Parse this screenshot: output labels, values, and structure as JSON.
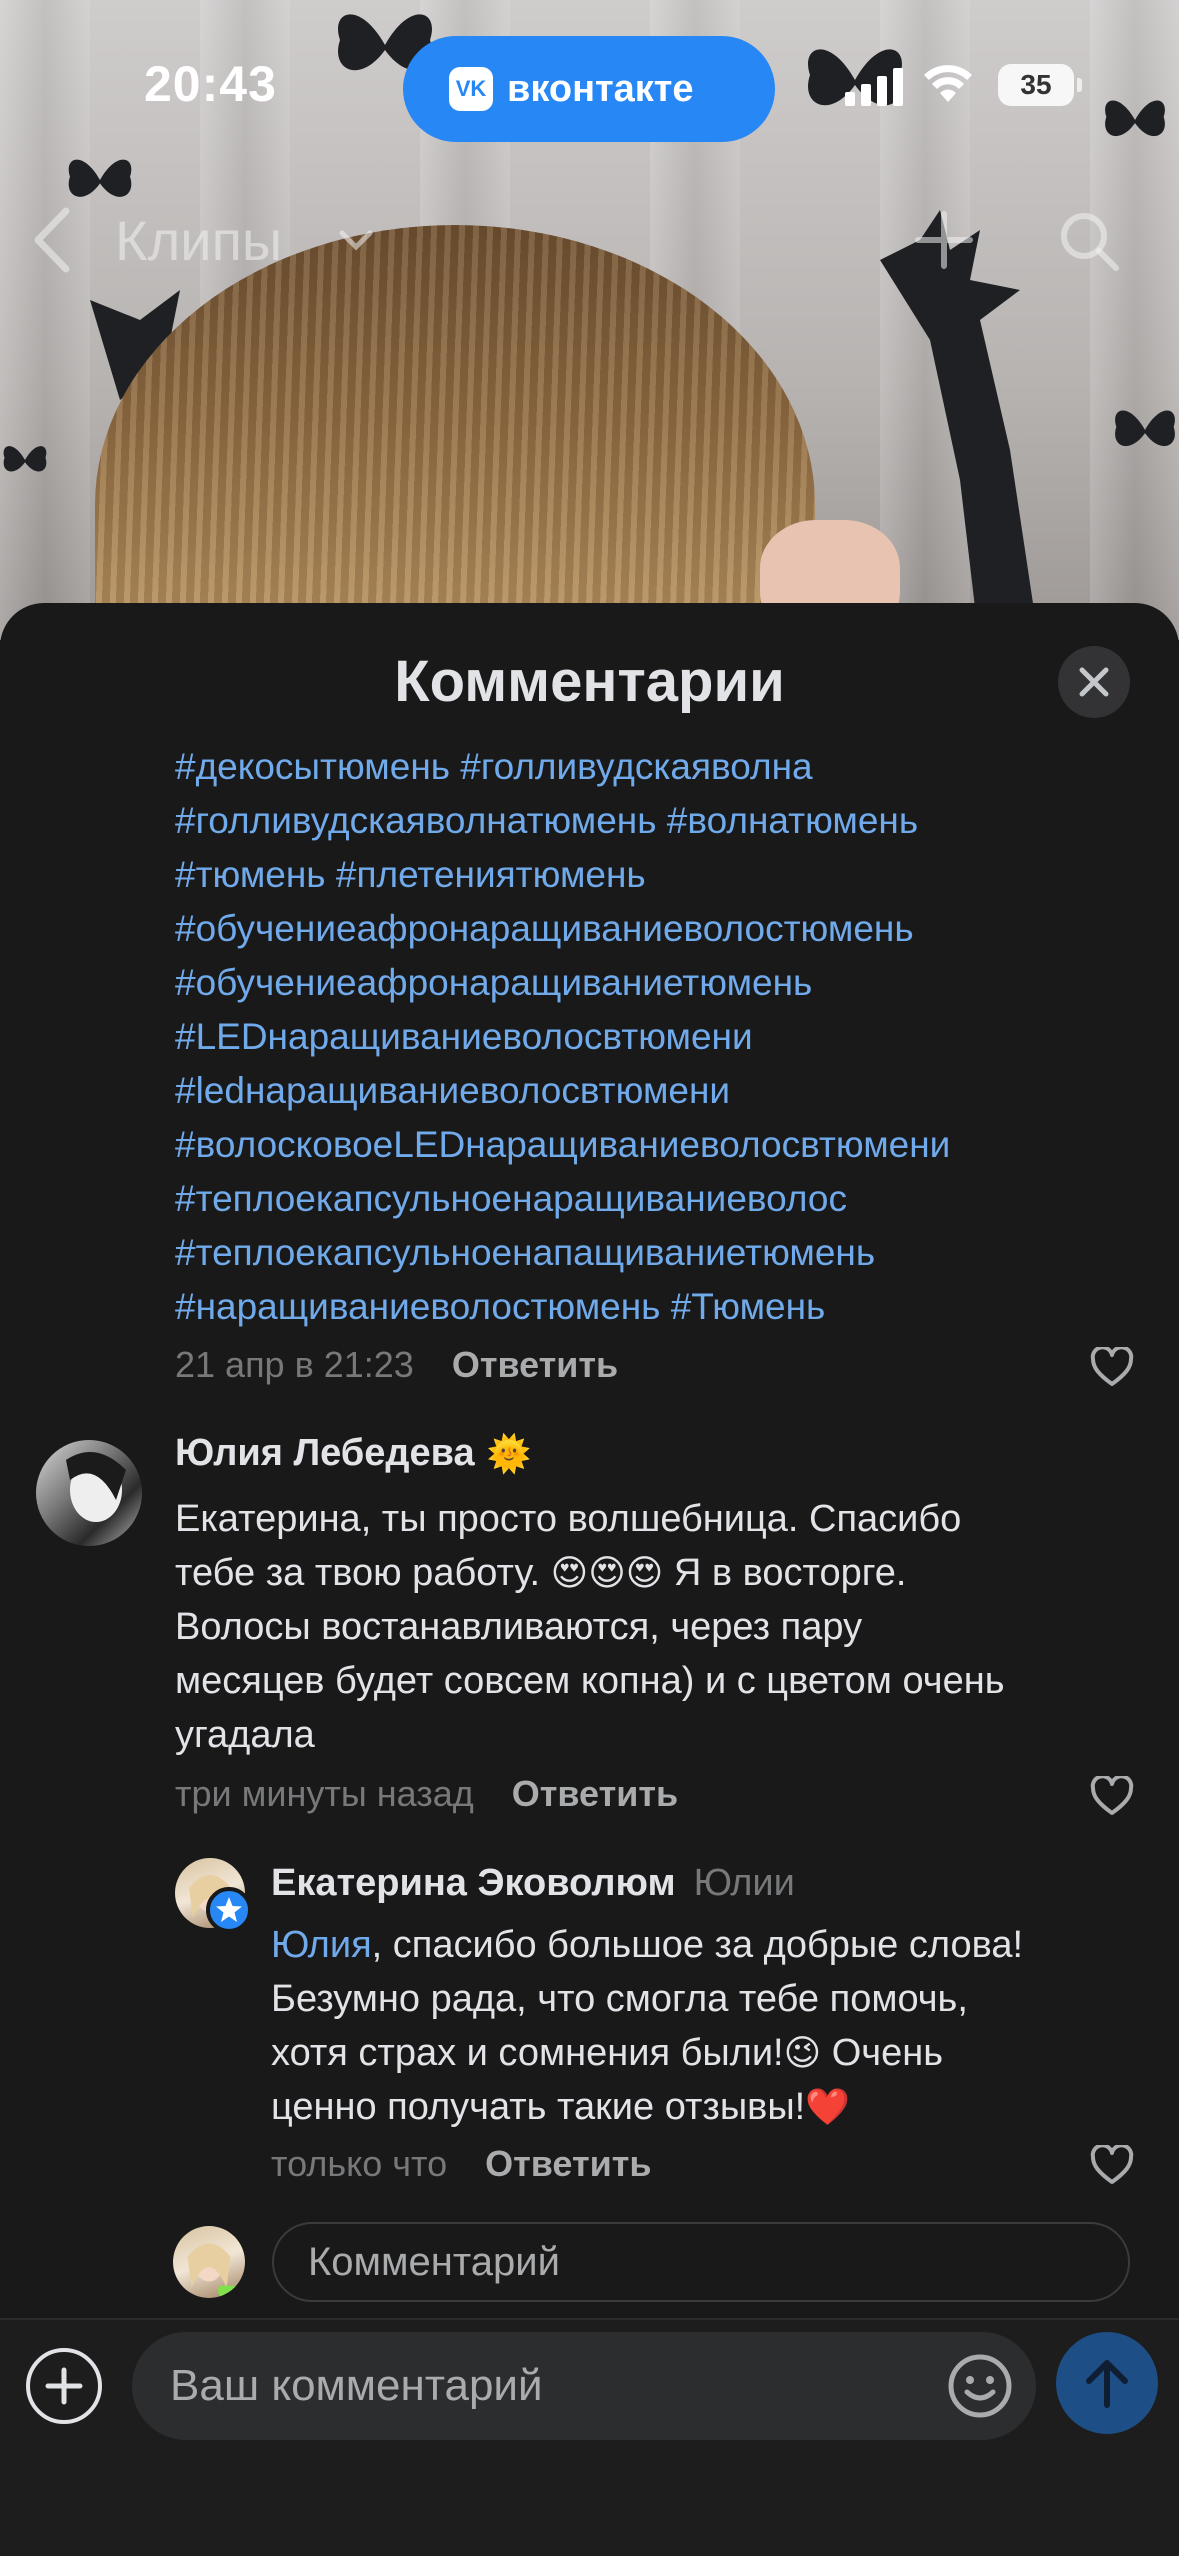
{
  "status_bar": {
    "time": "20:43",
    "app_pill_label": "вконтакте",
    "app_pill_logo": "VK",
    "battery": "35"
  },
  "nav": {
    "title": "Клипы"
  },
  "sheet": {
    "title": "Комментарии"
  },
  "comments": [
    {
      "hashtag_lines": [
        "#декосытюмень #голливудскаяволна",
        "#голливудскаяволнатюмень #волнатюмень",
        "#тюмень #плетениятюмень",
        "#обучениеафронаращиваниеволостюмень",
        "#обучениеафронаращиваниетюмень",
        "#LEDнаращиваниеволосвтюмени",
        "#ledнаращиваниеволосвтюмени",
        "#волосковоеLEDнаращиваниеволосвтюмени",
        "#теплоекапсульноенаращиваниеволос",
        "#теплоекапсульноенапащиваниетюмень",
        "#наращиваниеволостюмень #Тюмень"
      ],
      "time": "21 апр в 21:23",
      "reply_label": "Ответить"
    },
    {
      "author": "Юлия Лебедева",
      "author_badge": "🌞",
      "lines": [
        "Екатерина, ты просто волшебница. Спасибо",
        "тебе за твою работу.",
        "Волосы востанавливаются, через пару",
        "месяцев будет совсем копна) и с цветом очень",
        "угадала"
      ],
      "line2_emojis": "😍😍😍",
      "line2_tail": " Я в восторге.",
      "time": "три минуты назад",
      "reply_label": "Ответить"
    },
    {
      "author": "Екатерина Эковолюм",
      "addressee": "Юлии",
      "mention": "Юлия",
      "line1_rest": ", спасибо большое за добрые слова!",
      "line2": "Безумно рада, что смогла тебе помочь,",
      "line3_text": "хотя страх и сомнения были!",
      "line3_emoji": "😉",
      "line3_tail": " Очень",
      "line4_text": "ценно получать такие отзывы!",
      "line4_emoji": "❤️",
      "time": "только что",
      "reply_label": "Ответить"
    }
  ],
  "inline_input": {
    "placeholder": "Комментарий"
  },
  "composer": {
    "placeholder": "Ваш комментарий"
  },
  "colors": {
    "accent": "#2787f5",
    "link": "#71aaeb",
    "background": "#19191a"
  },
  "icons": [
    "back-icon",
    "chevron-down-icon",
    "plus-icon",
    "search-icon",
    "close-icon",
    "heart-icon",
    "verified-star-icon",
    "add-icon",
    "smile-icon",
    "send-arrow-icon"
  ]
}
